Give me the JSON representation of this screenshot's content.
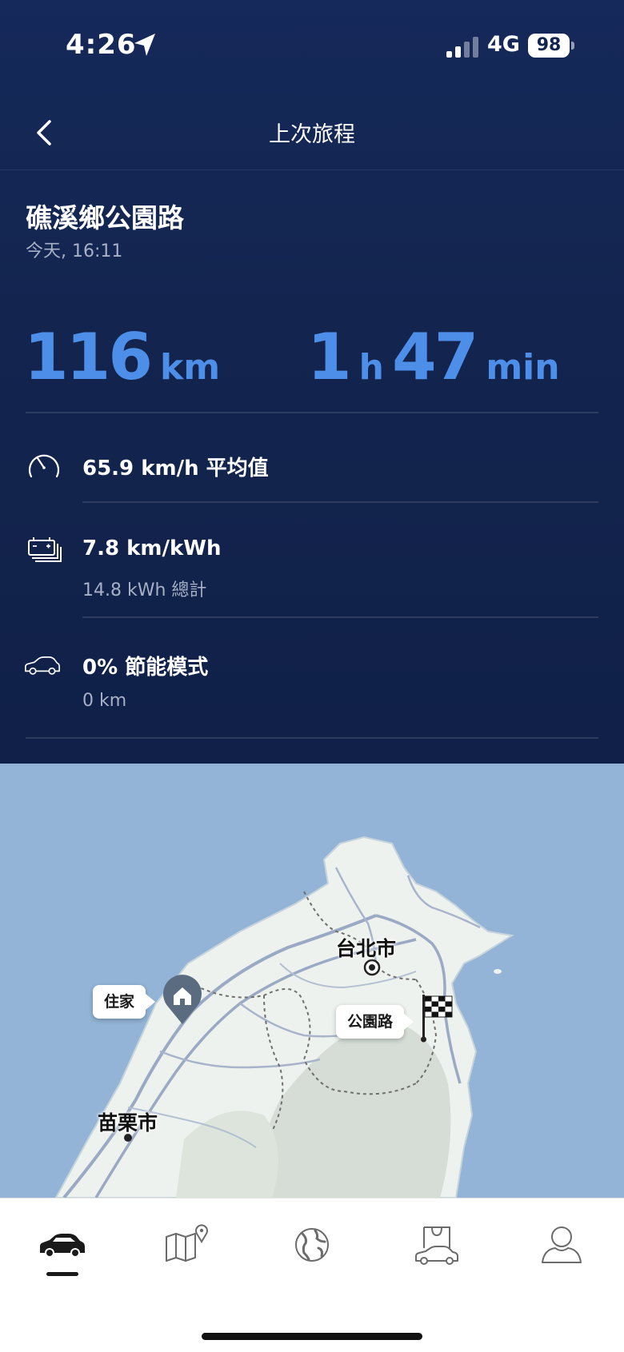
{
  "status_bar": {
    "time": "4:26",
    "network": "4G",
    "battery": "98"
  },
  "header": {
    "title": "上次旅程"
  },
  "trip": {
    "location": "礁溪鄉公園路",
    "timestamp": "今天, 16:11",
    "distance_value": "116",
    "distance_unit": "km",
    "duration_hours": "1",
    "duration_hours_unit": "h",
    "duration_minutes": "47",
    "duration_minutes_unit": "min"
  },
  "stats": {
    "speed": {
      "main": "65.9 km/h 平均值"
    },
    "efficiency": {
      "main": "7.8 km/kWh",
      "sub": "14.8 kWh 總計"
    },
    "eco": {
      "main": "0% 節能模式",
      "sub": "0 km"
    }
  },
  "map": {
    "home_label": "住家",
    "destination_label": "公園路",
    "city_taipei": "台北市",
    "city_miaoli": "苗栗市"
  },
  "tabs": [
    {
      "icon": "car-icon",
      "selected": true
    },
    {
      "icon": "map-pin-icon",
      "selected": false
    },
    {
      "icon": "globe-icon",
      "selected": false
    },
    {
      "icon": "shop-car-icon",
      "selected": false
    },
    {
      "icon": "profile-icon",
      "selected": false
    }
  ],
  "colors": {
    "accent": "#4d8fe8",
    "panel": "#13254f",
    "water": "#93b4d6"
  }
}
